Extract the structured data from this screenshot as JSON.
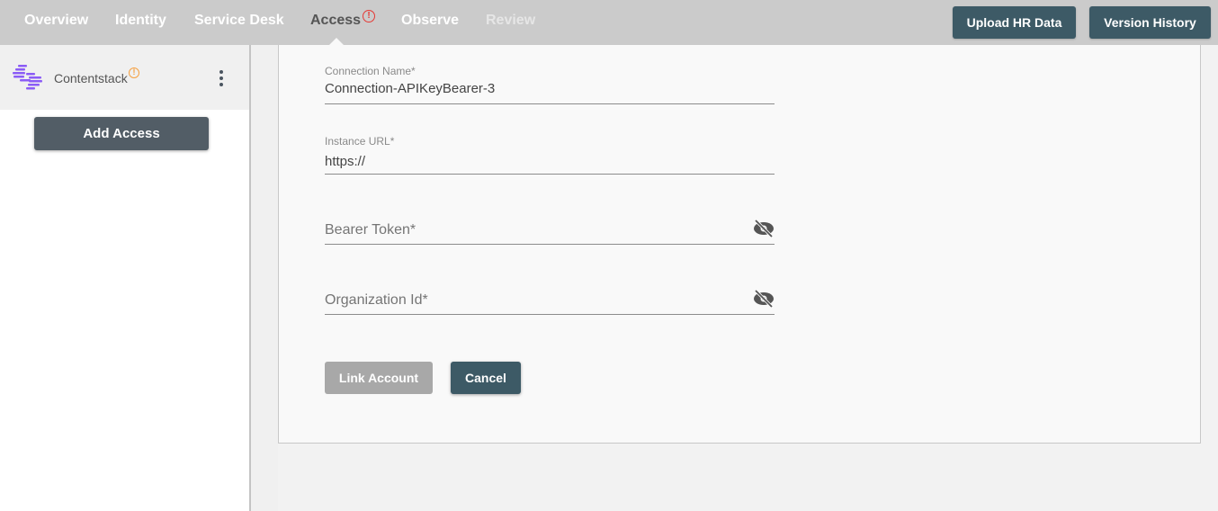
{
  "nav": {
    "items": [
      {
        "label": "Overview",
        "state": "normal"
      },
      {
        "label": "Identity",
        "state": "normal"
      },
      {
        "label": "Service Desk",
        "state": "normal"
      },
      {
        "label": "Access",
        "state": "active",
        "badge": "!"
      },
      {
        "label": "Observe",
        "state": "normal"
      },
      {
        "label": "Review",
        "state": "disabled"
      }
    ],
    "badge_color": "#e53935"
  },
  "toolbar": {
    "upload_hr_label": "Upload HR Data",
    "version_history_label": "Version History"
  },
  "sidebar": {
    "app": {
      "name": "Contentstack",
      "warning_badge": "!",
      "warning_color": "#f5a142",
      "logo_color": "#7c4dff",
      "menu_icon": "kebab-menu-icon"
    },
    "add_access_label": "Add Access"
  },
  "form": {
    "connection_name": {
      "label": "Connection Name*",
      "value": "Connection-APIKeyBearer-3"
    },
    "instance_url": {
      "label": "Instance URL*",
      "value": "https://"
    },
    "bearer_token": {
      "placeholder": "Bearer Token*",
      "value": "",
      "icon": "eye-off-icon"
    },
    "organization_id": {
      "placeholder": "Organization Id*",
      "value": "",
      "icon": "eye-off-icon"
    },
    "link_account_label": "Link Account",
    "cancel_label": "Cancel"
  },
  "colors": {
    "primary_button": "#3d5a66",
    "disabled_button": "#a8a8a8",
    "topbar": "#cbcbcb"
  }
}
